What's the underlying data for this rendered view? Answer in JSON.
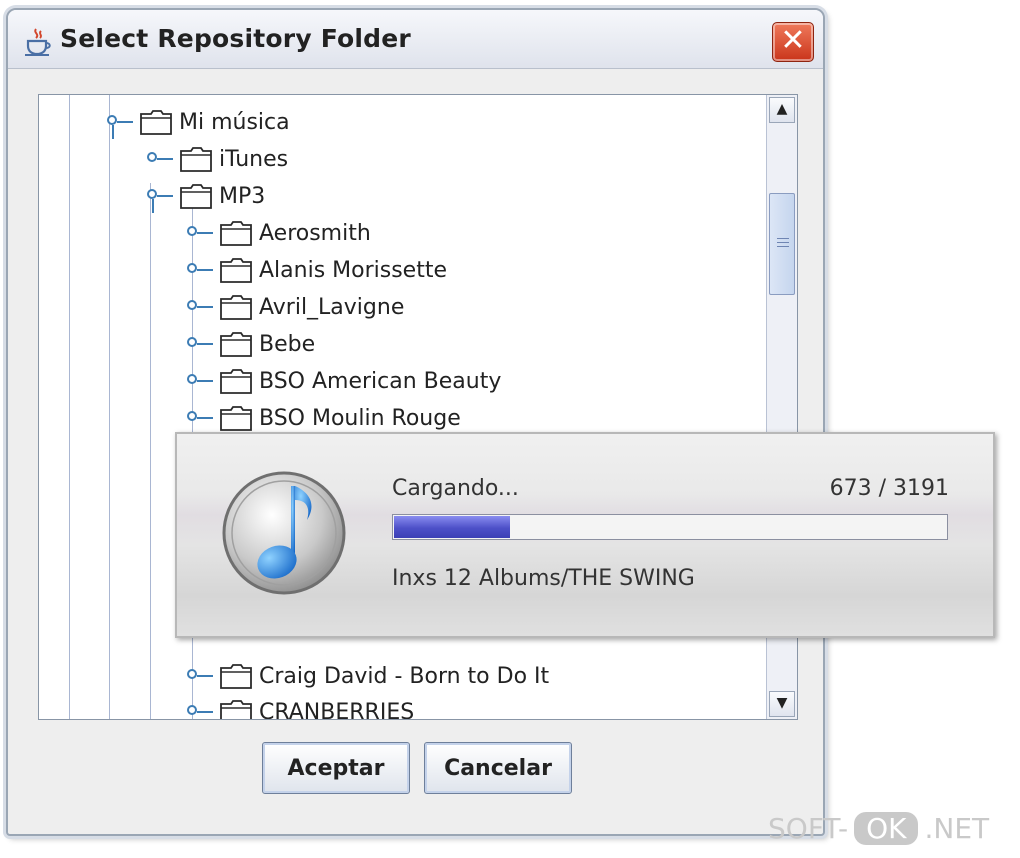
{
  "window": {
    "title": "Select Repository Folder",
    "close_symbol": "✕",
    "app_icon": "java-cup-icon"
  },
  "tree": {
    "items": [
      {
        "label": "Mi música",
        "level": 0,
        "expanded": true
      },
      {
        "label": "iTunes",
        "level": 1,
        "expanded": false
      },
      {
        "label": "MP3",
        "level": 1,
        "expanded": true
      },
      {
        "label": "Aerosmith",
        "level": 2,
        "expanded": false
      },
      {
        "label": "Alanis Morissette",
        "level": 2,
        "expanded": false
      },
      {
        "label": "Avril_Lavigne",
        "level": 2,
        "expanded": false
      },
      {
        "label": "Bebe",
        "level": 2,
        "expanded": false
      },
      {
        "label": "BSO American Beauty",
        "level": 2,
        "expanded": false
      },
      {
        "label": "BSO Moulin Rouge",
        "level": 2,
        "expanded": false
      },
      {
        "label": "Craig David - Born to Do It",
        "level": 2,
        "expanded": false
      },
      {
        "label": "CRANBERRIES",
        "level": 2,
        "expanded": false
      }
    ]
  },
  "buttons": {
    "accept": "Aceptar",
    "cancel": "Cancelar"
  },
  "loading": {
    "label": "Cargando...",
    "current": 673,
    "total": 3191,
    "count_text": "673 / 3191",
    "progress_fraction": 0.21,
    "current_file": "Inxs 12 Albums/THE SWING",
    "icon": "music-note-icon"
  },
  "watermark": {
    "left": "SOFT-",
    "pill": "OK",
    "right": ".NET"
  },
  "colors": {
    "progress": "#4d50c8",
    "close": "#d9442a",
    "tree_line": "#a9b6d2"
  }
}
